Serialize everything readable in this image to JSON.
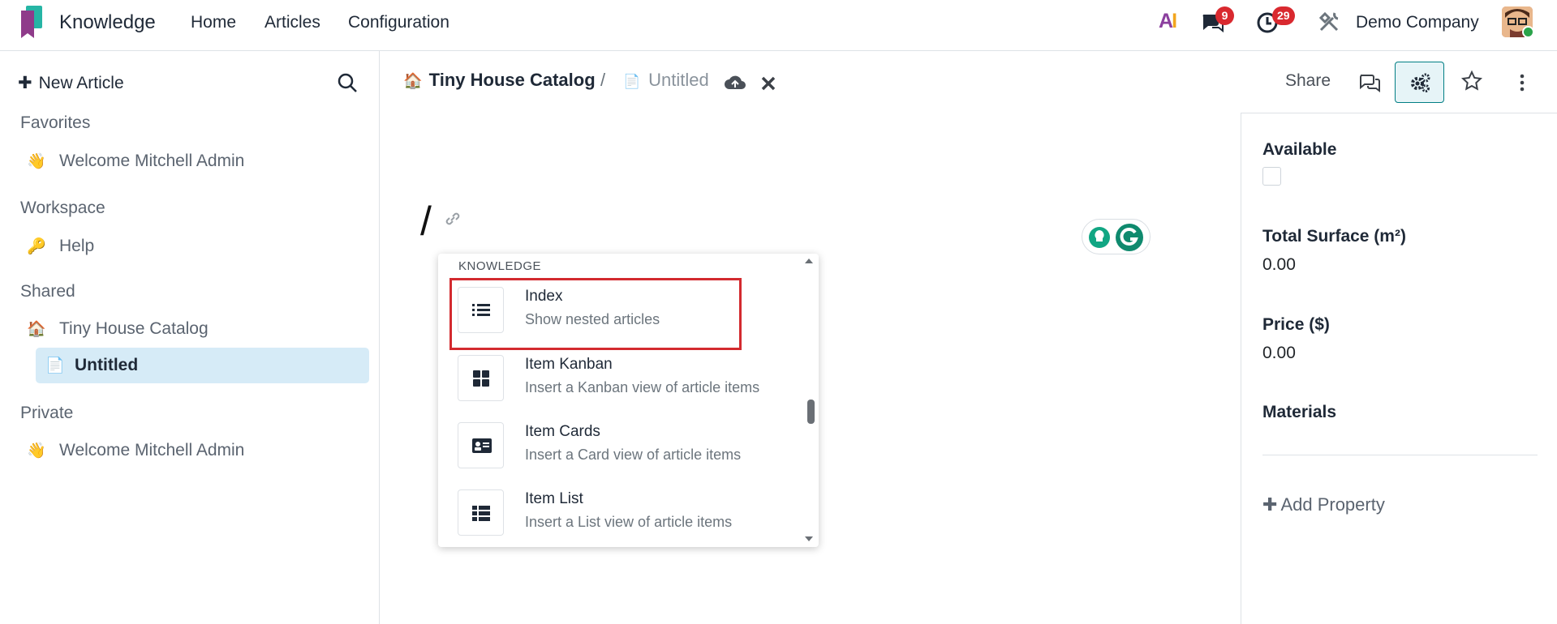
{
  "navbar": {
    "app_name": "Knowledge",
    "menu": [
      "Home",
      "Articles",
      "Configuration"
    ],
    "ai_label": "AI",
    "messages_count": "9",
    "activities_count": "29",
    "company": "Demo Company"
  },
  "sidebar": {
    "new_article_label": "New Article",
    "sections": {
      "favorites": "Favorites",
      "workspace": "Workspace",
      "shared": "Shared",
      "private": "Private"
    },
    "favorites": [
      {
        "emoji": "👋",
        "label": "Welcome Mitchell Admin"
      }
    ],
    "workspace": [
      {
        "emoji": "🔑",
        "label": "Help"
      }
    ],
    "shared": [
      {
        "emoji": "🏠",
        "label": "Tiny House Catalog"
      },
      {
        "emoji": "📄",
        "label": "Untitled",
        "active": true
      }
    ],
    "private": [
      {
        "emoji": "👋",
        "label": "Welcome Mitchell Admin"
      }
    ]
  },
  "header": {
    "breadcrumb_parent": "Tiny House Catalog",
    "breadcrumb_parent_emoji": "🏠",
    "breadcrumb_separator": "/",
    "breadcrumb_current": "Untitled",
    "breadcrumb_current_emoji": "📄",
    "share_label": "Share"
  },
  "editor": {
    "content": "/"
  },
  "command_palette": {
    "category": "KNOWLEDGE",
    "items": [
      {
        "icon": "list-icon",
        "title": "Index",
        "description": "Show nested articles"
      },
      {
        "icon": "kanban-icon",
        "title": "Item Kanban",
        "description": "Insert a Kanban view of article items"
      },
      {
        "icon": "card-icon",
        "title": "Item Cards",
        "description": "Insert a Card view of article items"
      },
      {
        "icon": "list-table-icon",
        "title": "Item List",
        "description": "Insert a List view of article items"
      }
    ],
    "highlighted_item": "Index"
  },
  "properties": {
    "available_label": "Available",
    "total_surface_label": "Total Surface (m²)",
    "total_surface_value": "0.00",
    "price_label": "Price ($)",
    "price_value": "0.00",
    "materials_label": "Materials",
    "add_property_label": "Add Property"
  },
  "colors": {
    "accent": "#017e84",
    "badge": "#d9292f",
    "active_item_bg": "#d6ebf7",
    "highlight_border": "#d32a2f"
  }
}
